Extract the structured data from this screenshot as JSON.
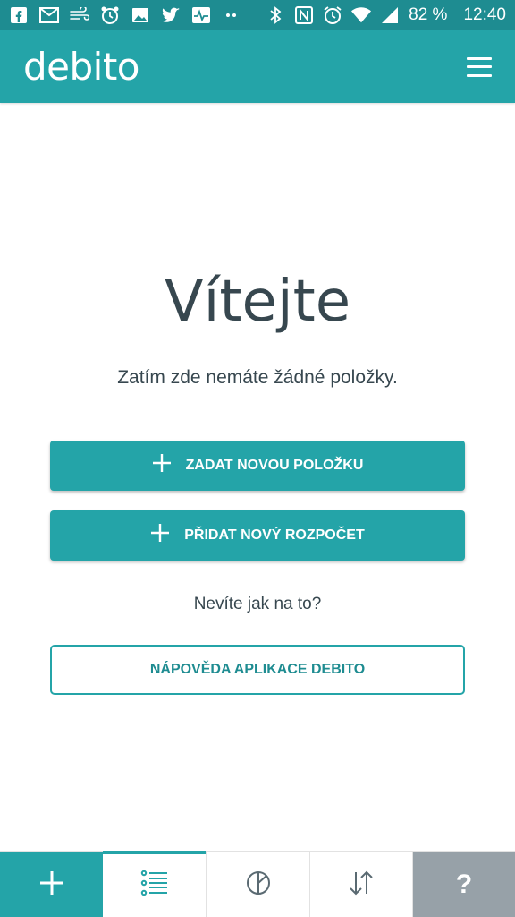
{
  "status_bar": {
    "battery": "82 %",
    "time": "12:40",
    "icons_left": [
      "facebook-icon",
      "gmail-icon",
      "wind-icon",
      "alarm-app-icon",
      "photo-icon",
      "twitter-icon",
      "activity-icon",
      "more-dots-icon"
    ],
    "icons_right": [
      "bluetooth-icon",
      "nfc-icon",
      "alarm-icon",
      "wifi-icon",
      "signal-icon"
    ]
  },
  "app_bar": {
    "logo": "debito",
    "menu_icon": "hamburger-menu-icon"
  },
  "main": {
    "title": "Vítejte",
    "empty_message": "Zatím zde nemáte žádné položky.",
    "btn_new_item": "ZADAT NOVOU POLOŽKU",
    "btn_new_budget": "PŘIDAT NOVÝ ROZPOČET",
    "help_question": "Nevíte jak na to?",
    "btn_help": "NÁPOVĚDA APLIKACE DEBITO"
  },
  "bottom_nav": {
    "items": [
      {
        "icon": "plus-icon",
        "active": false
      },
      {
        "icon": "list-icon",
        "active": true
      },
      {
        "icon": "pie-chart-icon",
        "active": false
      },
      {
        "icon": "sort-arrows-icon",
        "active": false
      },
      {
        "icon": "help-icon",
        "label": "?",
        "active": false
      }
    ]
  },
  "colors": {
    "primary": "#24a4a8",
    "status_bar": "#1e8c91",
    "text_dark": "#37474f",
    "help_gray": "#97a1a8"
  }
}
